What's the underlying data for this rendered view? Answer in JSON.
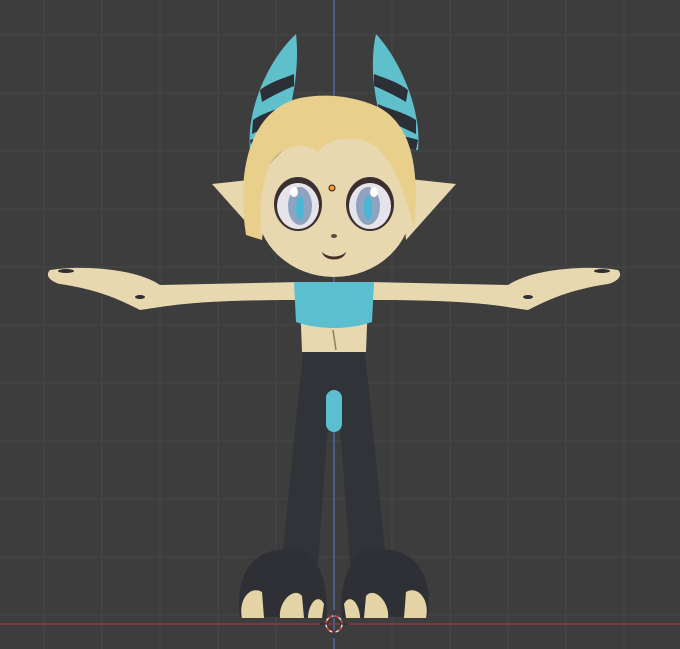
{
  "viewport": {
    "label": "",
    "background_color": "#3d3d3d",
    "grid_line_color": "#474747",
    "axis_x_color": "#8a3b45",
    "axis_z_color": "#4f6da3"
  },
  "model": {
    "object_type": "rigged-character-mesh",
    "pose": "T-pose",
    "view": "front-orthographic",
    "colors": {
      "skin": "#e8d8b0",
      "hair": "#e9cf8c",
      "horn_teal": "#5fc0cc",
      "horn_dark": "#2c2f36",
      "top_teal": "#5cbfd0",
      "pants_dark": "#303338",
      "claws": "#e4d3a5"
    }
  },
  "overlays": {
    "origin_point_icon": "orange-dot",
    "world_origin_icon": "3d-cursor"
  }
}
